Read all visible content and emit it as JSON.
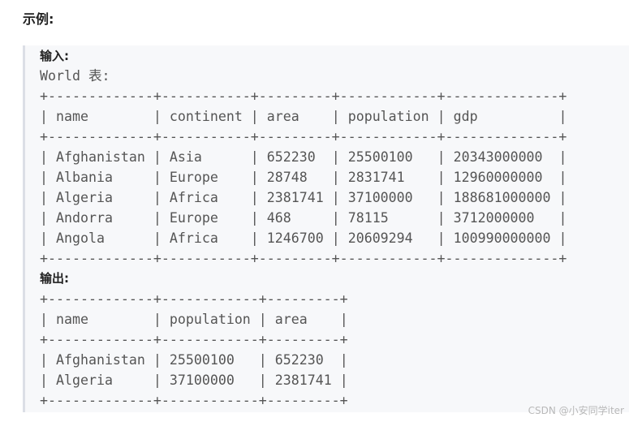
{
  "heading": "示例:",
  "input_label": "输入:",
  "table_caption": "World 表:",
  "world_table": {
    "columns": [
      "name",
      "continent",
      "area",
      "population",
      "gdp"
    ],
    "rows": [
      [
        "Afghanistan",
        "Asia",
        "652230",
        "25500100",
        "20343000000"
      ],
      [
        "Albania",
        "Europe",
        "28748",
        "2831741",
        "12960000000"
      ],
      [
        "Algeria",
        "Africa",
        "2381741",
        "37100000",
        "188681000000"
      ],
      [
        "Andorra",
        "Europe",
        "468",
        "78115",
        "3712000000"
      ],
      [
        "Angola",
        "Africa",
        "1246700",
        "20609294",
        "100990000000"
      ]
    ]
  },
  "output_label": "输出:",
  "output_table": {
    "columns": [
      "name",
      "population",
      "area"
    ],
    "rows": [
      [
        "Afghanistan",
        "25500100",
        "652230"
      ],
      [
        "Algeria",
        "37100000",
        "2381741"
      ]
    ]
  },
  "watermark": "CSDN @小安同学iter"
}
